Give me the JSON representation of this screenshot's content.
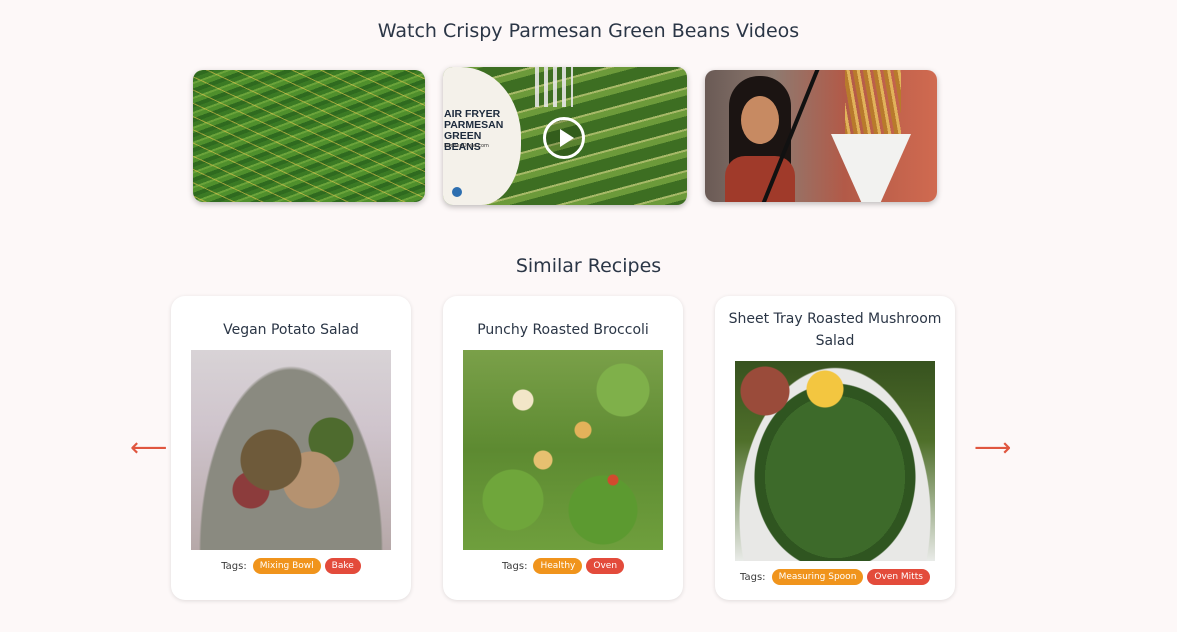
{
  "videos": {
    "title": "Watch Crispy Parmesan Green Beans Videos",
    "items": [
      {
        "overlay_text": ""
      },
      {
        "overlay_text": "AIR FRYER PARMESAN GREEN BEANS",
        "overlay_url": "KitchenDivas.com"
      },
      {
        "overlay_text": ""
      }
    ]
  },
  "similar": {
    "title": "Similar Recipes",
    "tags_label": "Tags:",
    "cards": [
      {
        "title": "Vegan Potato Salad",
        "tags": [
          {
            "label": "Mixing Bowl",
            "color": "#f0941c"
          },
          {
            "label": "Bake",
            "color": "#e34b3b"
          }
        ]
      },
      {
        "title": "Punchy Roasted Broccoli",
        "tags": [
          {
            "label": "Healthy",
            "color": "#f0941c"
          },
          {
            "label": "Oven",
            "color": "#e34b3b"
          }
        ]
      },
      {
        "title": "Sheet Tray Roasted Mushroom Salad",
        "tags": [
          {
            "label": "Measuring Spoon",
            "color": "#f0941c"
          },
          {
            "label": "Oven Mitts",
            "color": "#e34b3b"
          }
        ]
      }
    ]
  },
  "nav": {
    "prev_icon": "arrow-left-icon",
    "next_icon": "arrow-right-icon",
    "prev_glyph": "⟵",
    "next_glyph": "⟶"
  },
  "colors": {
    "background": "#fdf8f8",
    "accent_orange": "#f0941c",
    "accent_red": "#e34b3b",
    "arrow": "#e0563f"
  }
}
